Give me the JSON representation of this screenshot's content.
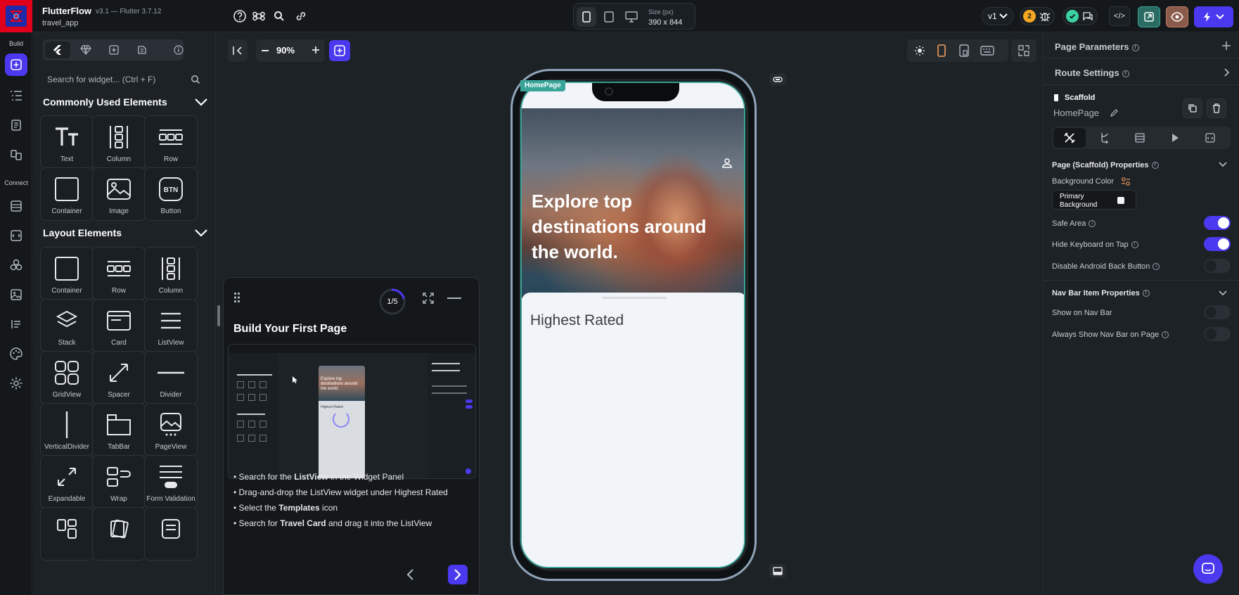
{
  "app": {
    "name": "FlutterFlow",
    "version": "v3.1 — Flutter 3.7.12",
    "project": "travel_app"
  },
  "toolbar": {
    "size_label": "Size (px)",
    "size_value": "390 x 844",
    "version_label": "v1",
    "debug_count": "2",
    "code_label": "</>"
  },
  "rail": {
    "build_label": "Build",
    "connect_label": "Connect"
  },
  "widget_panel": {
    "search_placeholder": "Search for widget... (Ctrl + F)",
    "common_title": "Commonly Used Elements",
    "layout_title": "Layout Elements",
    "common": [
      {
        "label": "Text",
        "icon": "text-icon"
      },
      {
        "label": "Column",
        "icon": "column-icon"
      },
      {
        "label": "Row",
        "icon": "row-icon"
      },
      {
        "label": "Container",
        "icon": "container-icon"
      },
      {
        "label": "Image",
        "icon": "image-icon"
      },
      {
        "label": "Button",
        "icon": "button-icon"
      }
    ],
    "layout": [
      {
        "label": "Container",
        "icon": "container-icon"
      },
      {
        "label": "Row",
        "icon": "row-icon"
      },
      {
        "label": "Column",
        "icon": "column-icon"
      },
      {
        "label": "Stack",
        "icon": "stack-icon"
      },
      {
        "label": "Card",
        "icon": "card-icon"
      },
      {
        "label": "ListView",
        "icon": "listview-icon"
      },
      {
        "label": "GridView",
        "icon": "gridview-icon"
      },
      {
        "label": "Spacer",
        "icon": "spacer-icon"
      },
      {
        "label": "Divider",
        "icon": "divider-icon"
      },
      {
        "label": "VerticalDivider",
        "icon": "vertical-divider-icon"
      },
      {
        "label": "TabBar",
        "icon": "tabbar-icon"
      },
      {
        "label": "PageView",
        "icon": "pageview-icon"
      },
      {
        "label": "Expandable",
        "icon": "expandable-icon"
      },
      {
        "label": "Wrap",
        "icon": "wrap-icon"
      },
      {
        "label": "Form Validation",
        "icon": "form-validation-icon"
      }
    ]
  },
  "canvas": {
    "zoom": "90%",
    "page_tag": "HomePage",
    "hero_title": "Explore top destinations around the world.",
    "section_title": "Highest Rated"
  },
  "tutorial": {
    "progress": "1/5",
    "progress_fraction": 0.2,
    "title": "Build Your First Page",
    "preview_hero": "Explore top destinations around the world.",
    "preview_section": "Highest Rated",
    "steps": [
      {
        "pre": "Search for the ",
        "bold": "ListView",
        "post": " in the Widget Panel"
      },
      {
        "pre": "Drag-and-drop the ListView widget under Highest Rated",
        "bold": "",
        "post": ""
      },
      {
        "pre": "Select the ",
        "bold": "Templates",
        "post": " icon"
      },
      {
        "pre": "Search for ",
        "bold": "Travel Card",
        "post": " and drag it into the ListView"
      }
    ]
  },
  "properties": {
    "page_parameters": "Page Parameters",
    "route_settings": "Route Settings",
    "widget_type": "Scaffold",
    "page_name": "HomePage",
    "scaffold_section": "Page (Scaffold) Properties",
    "background_color_label": "Background Color",
    "background_color_value": "Primary Background",
    "safe_area": "Safe Area",
    "hide_keyboard": "Hide Keyboard on Tap",
    "disable_back": "Disable Android Back Button",
    "navbar_section": "Nav Bar Item Properties",
    "show_nav_bar": "Show on Nav Bar",
    "always_show_nav": "Always Show Nav Bar on Page"
  },
  "colors": {
    "accent": "#4b39ef",
    "teal": "#39a599",
    "background": "#14181b",
    "panel": "#1d2226"
  }
}
